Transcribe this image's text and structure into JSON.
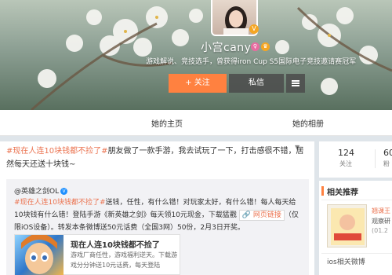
{
  "profile": {
    "username": "小宫cany",
    "bio": "游戏解说、竞技选手，曾获得iron Cup S5国际电子竞技邀请赛冠军"
  },
  "actions": {
    "follow": "+ 关注",
    "message": "私信"
  },
  "nav": {
    "tabs": [
      "她的主页",
      "她的相册"
    ]
  },
  "post": {
    "tag": "#现在人连10块钱都不捡了#",
    "text": "朋友做了一款手游，我去试玩了一下，打击感很不错，居然每天还送十块钱~"
  },
  "repost": {
    "author": "@英雄之剑OL",
    "tag": "#现在人连10块钱都不捡了#",
    "text_1": "送钱，任性，有什么错！对玩家太好，有什么错！每人每天给10块钱有什么错！登陆手游《新英雄之剑》每天领10元现金，下载猛戳",
    "link_label": "网页链接",
    "text_2": "（仅限iOS设备）。转发本条微博送50元话费（全国3网）50份，2月3日开奖。",
    "card": {
      "title": "现在人连10块钱都不捡了",
      "desc": "游戏厂商任性，游戏福利逆天。下载游戏分分钟送10元话费，每天登陆"
    }
  },
  "stats": [
    {
      "value": "124",
      "label": "关注"
    },
    {
      "value": "60",
      "label": "粉"
    }
  ],
  "recommend": {
    "title": "相关推荐",
    "item": {
      "line1": "翘课王",
      "line2": "观察研",
      "line3": "(01.2"
    },
    "footer": "ios相关微博"
  },
  "colors": {
    "accent": "#ff8140",
    "tag": "#eb7350",
    "verified": "#f5a623"
  }
}
